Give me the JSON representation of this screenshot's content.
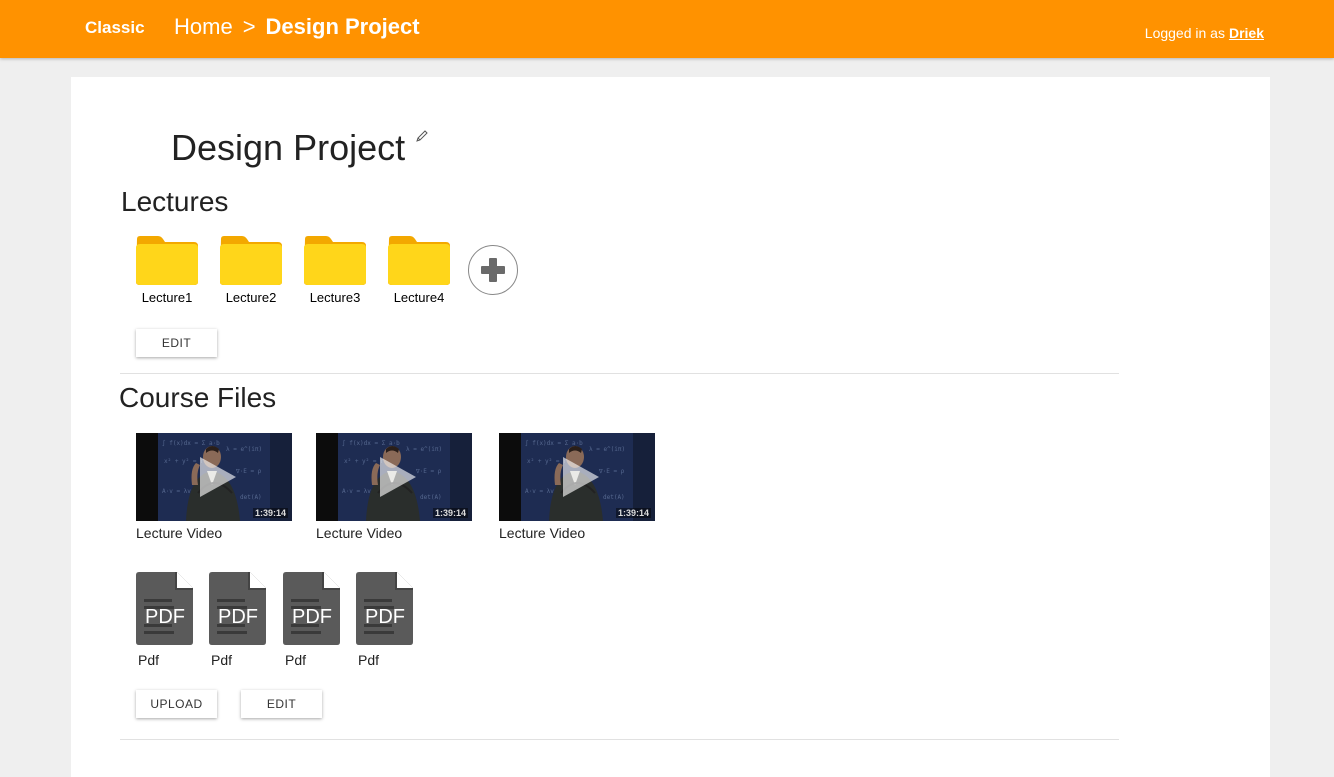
{
  "header": {
    "brand": "Classic",
    "breadcrumb": {
      "home": "Home",
      "separator": ">",
      "current": "Design Project"
    },
    "login_prefix": "Logged in as",
    "user": "Driek",
    "color": "#ff9200"
  },
  "page": {
    "title": "Design Project",
    "edit_icon": "pencil-icon"
  },
  "lectures": {
    "title": "Lectures",
    "folders": [
      {
        "label": "Lecture1"
      },
      {
        "label": "Lecture2"
      },
      {
        "label": "Lecture3"
      },
      {
        "label": "Lecture4"
      }
    ],
    "add_icon": "plus-circle-icon",
    "edit_label": "EDIT"
  },
  "course_files": {
    "title": "Course Files",
    "videos": [
      {
        "label": "Lecture Video",
        "duration": "1:39:14"
      },
      {
        "label": "Lecture Video",
        "duration": "1:39:14"
      },
      {
        "label": "Lecture Video",
        "duration": "1:39:14"
      }
    ],
    "pdfs": [
      {
        "label": "Pdf",
        "icon_text": "PDF"
      },
      {
        "label": "Pdf",
        "icon_text": "PDF"
      },
      {
        "label": "Pdf",
        "icon_text": "PDF"
      },
      {
        "label": "Pdf",
        "icon_text": "PDF"
      }
    ],
    "upload_label": "UPLOAD",
    "edit_label": "EDIT"
  }
}
